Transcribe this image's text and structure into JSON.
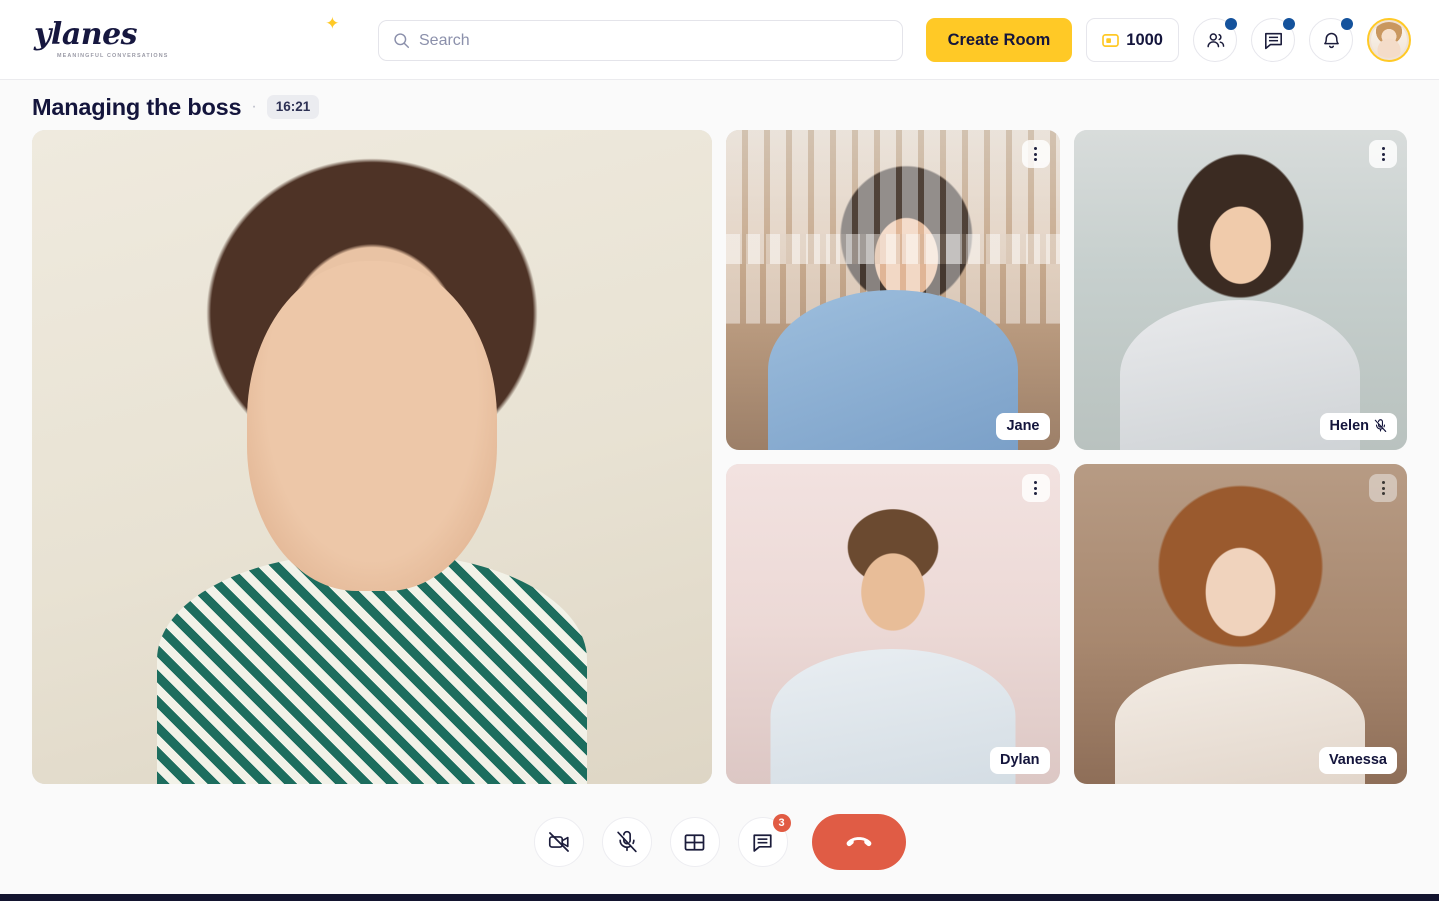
{
  "header": {
    "logo": {
      "wordmark": "ylanes",
      "tagline": "MEANINGFUL CONVERSATIONS",
      "dot_icon": "bird-dot-icon",
      "accent": "#ffc926"
    },
    "search": {
      "placeholder": "Search",
      "value": "",
      "icon": "search-icon"
    },
    "create_room_label": "Create Room",
    "coins": {
      "value": "1000",
      "icon": "wallet-icon"
    },
    "actions": [
      {
        "name": "contacts-icon",
        "has_badge": true
      },
      {
        "name": "messages-icon",
        "has_badge": true
      },
      {
        "name": "notifications-icon",
        "has_badge": true
      }
    ],
    "badge_color": "#14529c",
    "avatar": {
      "icon": "avatar",
      "ring_color": "#ffc926"
    }
  },
  "room": {
    "title": "Managing the boss",
    "separator": "·",
    "timer": "16:21"
  },
  "stage": {
    "main_tile": {
      "name": "",
      "menu_icon": "kebab-menu-icon",
      "photo": "p-main"
    },
    "tiles": [
      {
        "name": "Jane",
        "muted": false,
        "menu_icon": "kebab-menu-icon",
        "photo": "p-jane"
      },
      {
        "name": "Helen",
        "muted": true,
        "mute_icon": "mic-off-icon",
        "menu_icon": "kebab-menu-icon",
        "photo": "p-helen"
      },
      {
        "name": "Dylan",
        "muted": false,
        "menu_icon": "kebab-menu-icon",
        "photo": "p-dylan"
      },
      {
        "name": "Vanessa",
        "muted": false,
        "menu_icon": "kebab-menu-icon",
        "photo": "p-vanessa"
      }
    ]
  },
  "controls": {
    "buttons": [
      {
        "icon": "camera-off-icon",
        "label": "",
        "badge": ""
      },
      {
        "icon": "mic-off-icon",
        "label": "",
        "badge": ""
      },
      {
        "icon": "grid-layout-icon",
        "label": "",
        "badge": ""
      },
      {
        "icon": "chat-icon",
        "label": "",
        "badge": "3"
      }
    ],
    "hangup": {
      "icon": "hangup-icon",
      "color": "#e05c45"
    },
    "badge_color": "#e15b43"
  }
}
